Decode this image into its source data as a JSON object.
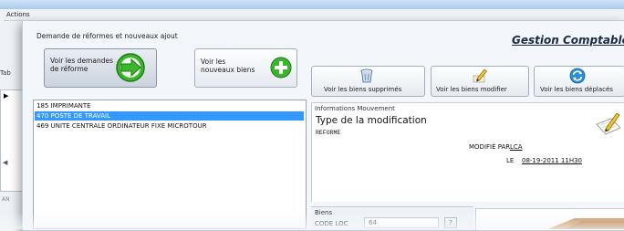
{
  "back_window": {
    "actions_label": "Actions",
    "tab_stub": "Tab",
    "row_arrow": "▶",
    "scroll_arrow": "◀",
    "bottom_stub": "AN"
  },
  "group": {
    "title": "Demande de réformes et nouveaux ajout",
    "app_title": "Gestion Comptable"
  },
  "buttons": {
    "demandes_label": "Voir les demandes\nde réforme",
    "nouveaux_label": "Voir les\nnouveaux biens",
    "supprimes_label": "Voir les biens supprimés",
    "modifier_label": "Voir les biens modifier",
    "deplaces_label": "Voir les biens déplacés"
  },
  "list": {
    "items": [
      "185 IMPRIMANTE",
      "470 POSTE DE TRAVAIL",
      "469 UNITE CENTRALE ORDINATEUR FIXE MICROTOUR"
    ],
    "selected_index": 1
  },
  "info": {
    "title": "Informations Mouvement",
    "subtitle": "Type de la modification",
    "text": "REFORME",
    "modifie_par_label": "MODIFIÉ PAR",
    "modifie_par_value": "LCA",
    "le_label": "LE",
    "le_value": "08-19-2011 11H30"
  },
  "biens": {
    "title": "Biens",
    "code_loc_label": "CODE LOC",
    "code_loc_value": "64",
    "help_label": "?"
  },
  "colors": {
    "selection": "#3399ff",
    "green_icon": "#3cb52e",
    "title_text": "#1c2a44"
  },
  "icons": [
    "arrow-go-icon",
    "plus-icon",
    "trash-icon",
    "pencil-icon",
    "refresh-icon",
    "edit-document-icon"
  ]
}
